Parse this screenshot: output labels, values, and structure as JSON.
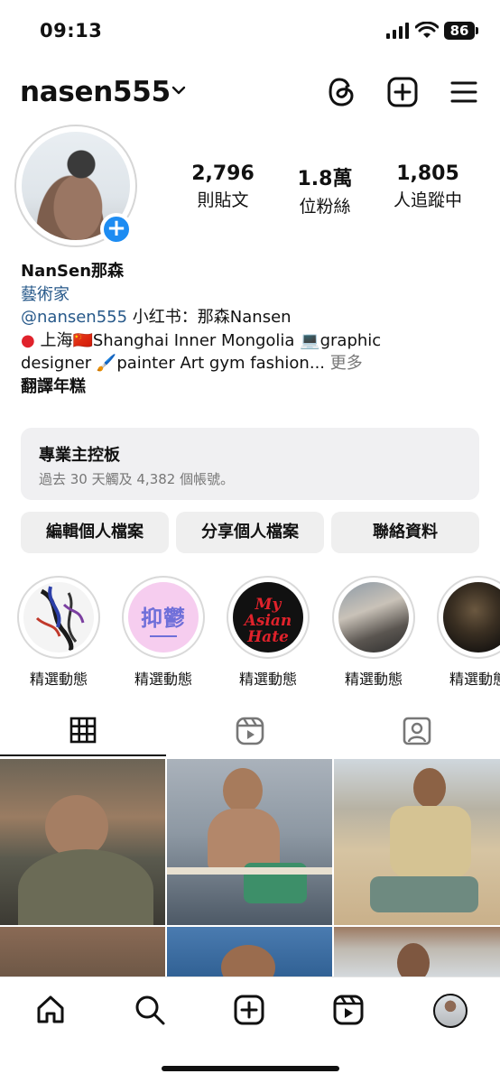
{
  "status_bar": {
    "time": "09:13",
    "battery": "86"
  },
  "header": {
    "username": "nasen555",
    "icons": [
      "threads-icon",
      "add-post-icon",
      "menu-icon"
    ]
  },
  "profile": {
    "stats": [
      {
        "value": "2,796",
        "label": "則貼文"
      },
      {
        "value": "1.8萬",
        "label": "位粉絲"
      },
      {
        "value": "1,805",
        "label": "人追蹤中"
      }
    ],
    "name": "NanSen那森",
    "category": "藝術家",
    "bio": {
      "handle": "@nansen555",
      "line1_rest": "  小红书：那森Nansen",
      "line2": " 上海🇨🇳Shanghai  Inner Mongolia  💻graphic",
      "line3": "designer  🖌️painter  Art gym fashion...",
      "more": "更多",
      "translate": "翻譯年糕"
    }
  },
  "dashboard": {
    "title": "專業主控板",
    "subtitle": "過去 30 天觸及 4,382 個帳號。"
  },
  "buttons": {
    "edit": "編輯個人檔案",
    "share": "分享個人檔案",
    "contact": "聯絡資料"
  },
  "highlights": [
    {
      "label": "精選動態"
    },
    {
      "label": "精選動態",
      "art_text": "抑鬱"
    },
    {
      "label": "精選動態",
      "art_text": "My Asian Hate"
    },
    {
      "label": "精選動態"
    },
    {
      "label": "精選動態"
    }
  ],
  "tabs": [
    "grid-tab",
    "reels-tab",
    "tagged-tab"
  ],
  "nav": [
    "home",
    "search",
    "create",
    "reels",
    "profile"
  ],
  "colors": {
    "accent_blue": "#1d8cf2",
    "link_blue": "#27598a",
    "pin_red": "#e0222b"
  }
}
